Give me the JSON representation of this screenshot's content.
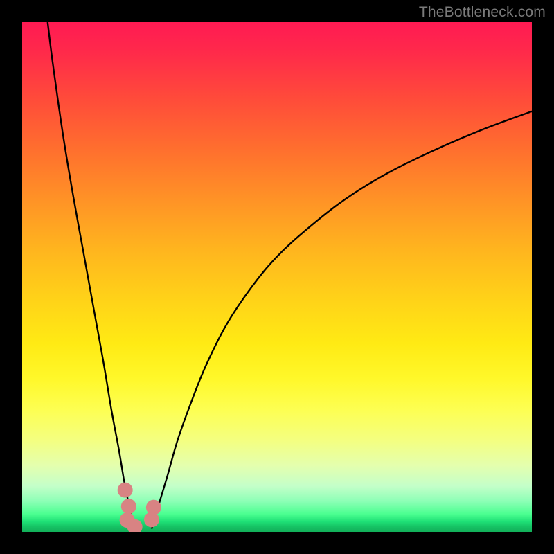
{
  "watermark": "TheBottleneck.com",
  "chart_data": {
    "type": "line",
    "title": "",
    "xlabel": "",
    "ylabel": "",
    "xlim": [
      0,
      100
    ],
    "ylim": [
      0,
      100
    ],
    "series": [
      {
        "name": "left-curve",
        "x": [
          5,
          6,
          8,
          10,
          12,
          14,
          16,
          17.5,
          19,
          20,
          20.8,
          21.4,
          21.9,
          22.3
        ],
        "y": [
          100,
          92,
          78,
          66,
          55,
          44,
          33,
          24,
          16,
          10,
          6,
          3.5,
          1.8,
          0.6
        ]
      },
      {
        "name": "right-curve",
        "x": [
          25.4,
          26,
          27,
          28.5,
          30.5,
          33,
          36,
          40,
          45,
          50,
          56,
          63,
          71,
          80,
          90,
          100
        ],
        "y": [
          0.6,
          2.5,
          6,
          11,
          18,
          25,
          32.5,
          40.5,
          48,
          54,
          59.5,
          65,
          70,
          74.5,
          78.8,
          82.5
        ]
      }
    ],
    "markers": [
      {
        "x": 20.2,
        "y": 8.2
      },
      {
        "x": 20.9,
        "y": 5.0
      },
      {
        "x": 20.6,
        "y": 2.3
      },
      {
        "x": 22.1,
        "y": 1.0
      },
      {
        "x": 25.8,
        "y": 4.8
      },
      {
        "x": 25.4,
        "y": 2.4
      }
    ],
    "marker_color": "#d88383",
    "curve_color": "#000000"
  }
}
